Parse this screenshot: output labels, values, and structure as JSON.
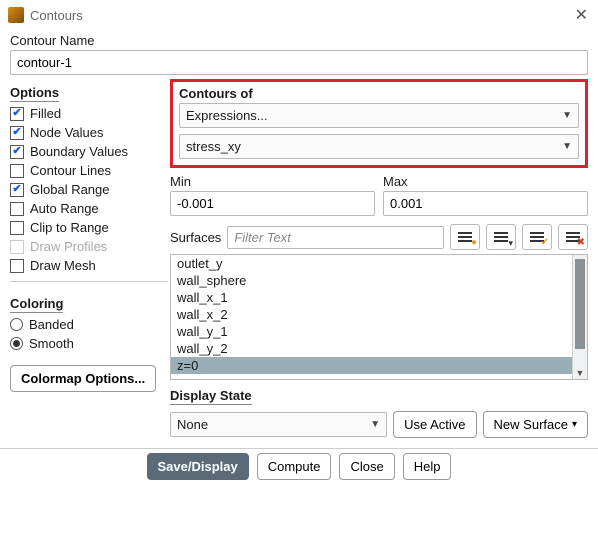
{
  "window": {
    "title": "Contours"
  },
  "name_section": {
    "label": "Contour Name",
    "value": "contour-1"
  },
  "options": {
    "title": "Options",
    "items": [
      {
        "label": "Filled",
        "checked": true,
        "enabled": true
      },
      {
        "label": "Node Values",
        "checked": true,
        "enabled": true
      },
      {
        "label": "Boundary Values",
        "checked": true,
        "enabled": true
      },
      {
        "label": "Contour Lines",
        "checked": false,
        "enabled": true
      },
      {
        "label": "Global Range",
        "checked": true,
        "enabled": true
      },
      {
        "label": "Auto Range",
        "checked": false,
        "enabled": true
      },
      {
        "label": "Clip to Range",
        "checked": false,
        "enabled": true
      },
      {
        "label": "Draw Profiles",
        "checked": false,
        "enabled": false
      },
      {
        "label": "Draw Mesh",
        "checked": false,
        "enabled": true
      }
    ]
  },
  "coloring": {
    "title": "Coloring",
    "options": [
      {
        "label": "Banded",
        "selected": false
      },
      {
        "label": "Smooth",
        "selected": true
      }
    ]
  },
  "colormap_btn": "Colormap Options...",
  "contours_of": {
    "title": "Contours of",
    "primary": "Expressions...",
    "secondary": "stress_xy"
  },
  "range": {
    "min_label": "Min",
    "min_value": "-0.001",
    "max_label": "Max",
    "max_value": "0.001"
  },
  "surfaces": {
    "label": "Surfaces",
    "filter_placeholder": "Filter Text",
    "items": [
      "outlet_y",
      "wall_sphere",
      "wall_x_1",
      "wall_x_2",
      "wall_y_1",
      "wall_y_2",
      "z=0"
    ],
    "selected": "z=0"
  },
  "icons": {
    "filter_highlight": "search",
    "select_toggle": "toggle",
    "select_all": "all",
    "deselect_all": "none"
  },
  "display_state": {
    "title": "Display State",
    "value": "None",
    "use_active": "Use Active",
    "new_surface": "New Surface"
  },
  "footer": {
    "save": "Save/Display",
    "compute": "Compute",
    "close": "Close",
    "help": "Help"
  }
}
